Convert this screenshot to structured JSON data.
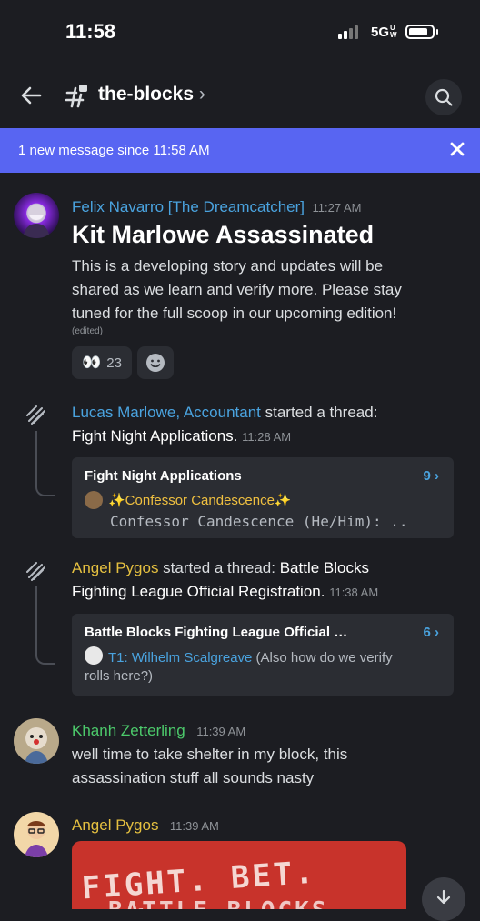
{
  "status_bar": {
    "time": "11:58",
    "network": "5G"
  },
  "header": {
    "channel_name": "the-blocks",
    "chevron": "›"
  },
  "banner": {
    "text": "1 new message since 11:58 AM"
  },
  "messages": [
    {
      "author": "Felix Navarro [The Dreamcatcher]",
      "author_color": "#4aa3df",
      "time": "11:27 AM",
      "title": "Kit Marlowe Assassinated",
      "lines": [
        "This is a developing story and updates will be",
        "shared as we learn and verify more. Please stay",
        "tuned for the full scoop in our upcoming edition!"
      ],
      "edited": "(edited)",
      "reactions": [
        {
          "emoji": "👀",
          "count": "23"
        }
      ]
    },
    {
      "actor": "Lucas Marlowe, Accountant",
      "actor_color": "#4aa3df",
      "action": " started a thread:",
      "thread_name": "Fight Night Applications.",
      "time": "11:28 AM",
      "card": {
        "title": "Fight Night Applications",
        "count": "9 ›",
        "last_author": "✨Confessor Candescence✨",
        "last_preview": "Confessor Candescence (He/Him): .."
      }
    },
    {
      "actor": "Angel Pygos",
      "actor_color": "#e5c040",
      "action": " started a thread: ",
      "thread_name_1": "Battle Blocks",
      "thread_name_2": "Fighting League Official Registration.",
      "time": "11:38 AM",
      "card": {
        "title": "Battle Blocks Fighting League Official …",
        "count": "6 ›",
        "last_author": "T1: Wilhelm Scalgreave",
        "last_preview_1": " (Also how do we verify",
        "last_preview_2": "rolls here?)"
      }
    },
    {
      "author": "Khanh Zetterling",
      "author_color": "#4cc96b",
      "time": "11:39 AM",
      "lines": [
        "well time to take shelter in my block, this",
        "assassination stuff all sounds nasty"
      ]
    },
    {
      "author": "Angel Pygos",
      "author_color": "#e5c040",
      "time": "11:39 AM",
      "image_text": "FIGHT. BET. WIN.",
      "image_text_2": "BATTLE BLOCKS"
    }
  ]
}
